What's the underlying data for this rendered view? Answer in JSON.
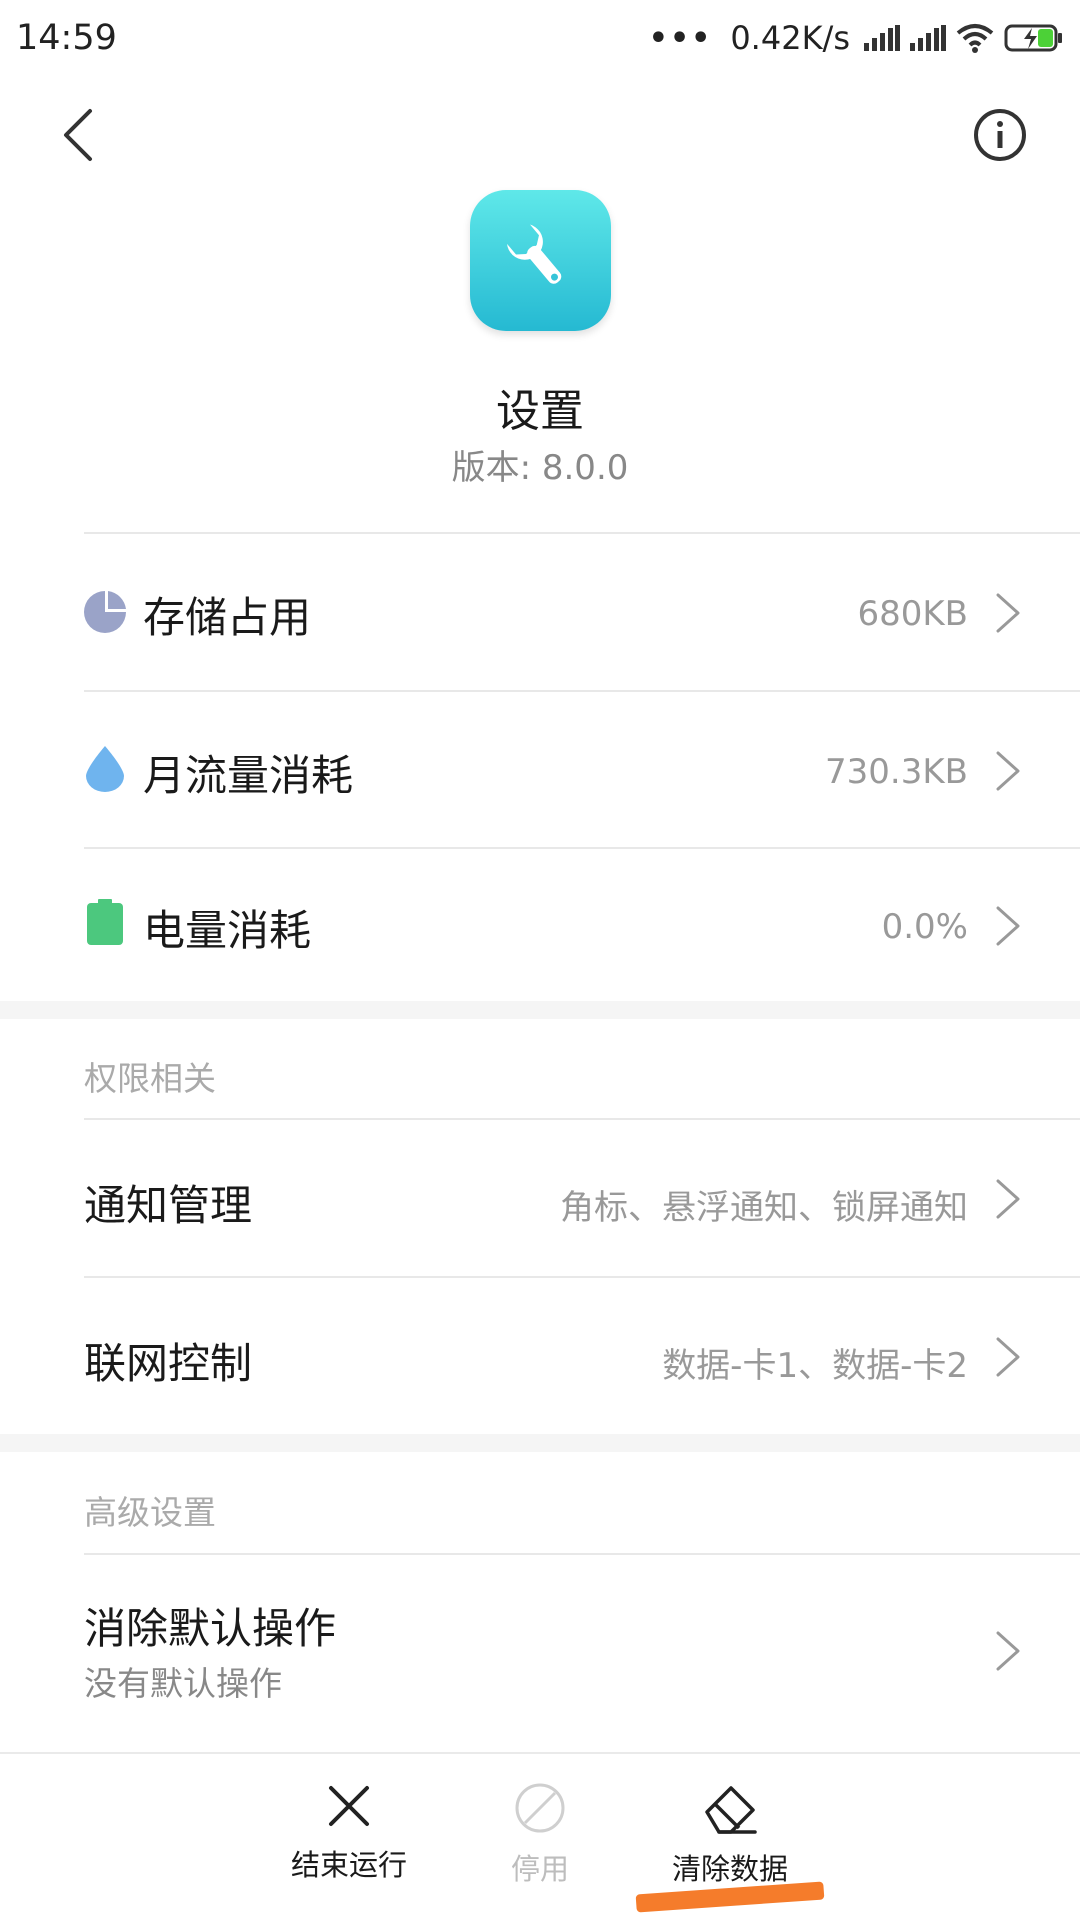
{
  "status_bar": {
    "time": "14:59",
    "dots": "•••",
    "speed": "0.42K/s"
  },
  "app": {
    "name": "设置",
    "version": "版本: 8.0.0",
    "icon": "wrench-icon",
    "icon_colors": [
      "#5fe8e9",
      "#25b9d2"
    ]
  },
  "usage": [
    {
      "label": "存储占用",
      "value": "680KB",
      "icon": "pie-chart-icon",
      "color": "#9aa3c8"
    },
    {
      "label": "月流量消耗",
      "value": "730.3KB",
      "icon": "water-drop-icon",
      "color": "#6fb4ee"
    },
    {
      "label": "电量消耗",
      "value": "0.0%",
      "icon": "battery-icon",
      "color": "#4cc87e"
    }
  ],
  "permissions": {
    "section_label": "权限相关",
    "items": [
      {
        "label": "通知管理",
        "value": "角标、悬浮通知、锁屏通知"
      },
      {
        "label": "联网控制",
        "value": "数据-卡1、数据-卡2"
      }
    ]
  },
  "advanced": {
    "section_label": "高级设置",
    "items": [
      {
        "label": "消除默认操作",
        "sub": "没有默认操作"
      }
    ]
  },
  "bottom_bar": {
    "items": [
      {
        "label": "结束运行",
        "icon": "close-icon",
        "enabled": true
      },
      {
        "label": "停用",
        "icon": "disable-icon",
        "enabled": false
      },
      {
        "label": "清除数据",
        "icon": "eraser-icon",
        "enabled": true
      }
    ],
    "highlight_color": "#f57c2b"
  }
}
